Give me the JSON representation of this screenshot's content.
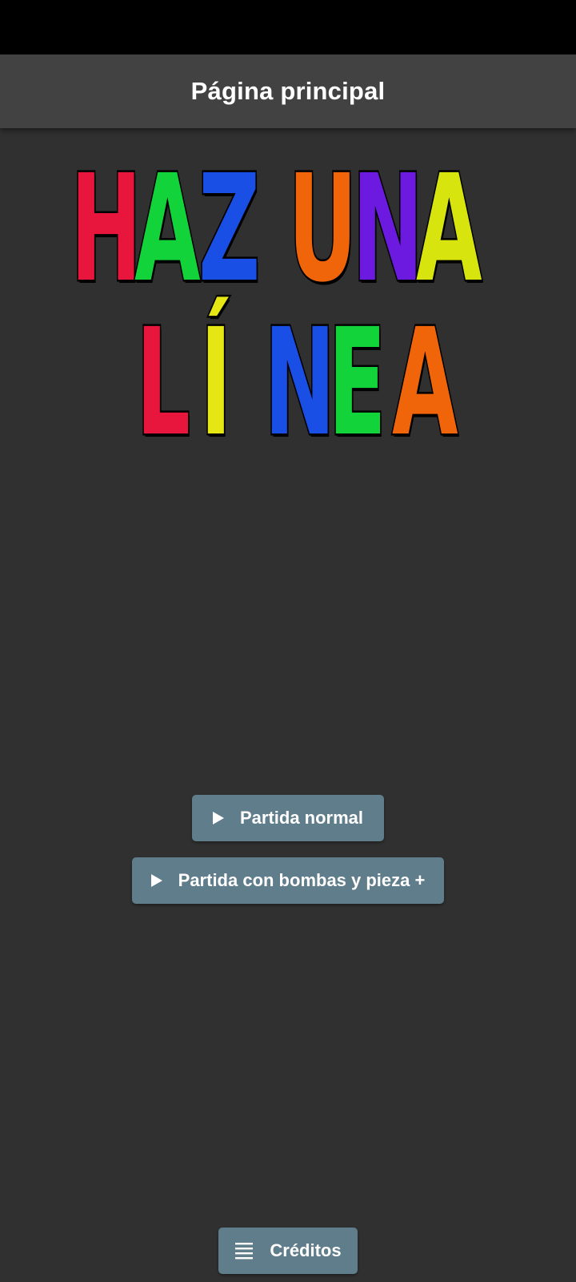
{
  "app_bar": {
    "title": "Página principal"
  },
  "logo": {
    "line1": [
      {
        "char": "H",
        "color": "#e8163c"
      },
      {
        "char": "A",
        "color": "#12d43a"
      },
      {
        "char": "Z",
        "color": "#1a4fe6"
      },
      {
        "char": " ",
        "color": "#000000"
      },
      {
        "char": "U",
        "color": "#f0640a"
      },
      {
        "char": "N",
        "color": "#6c1ae0"
      },
      {
        "char": "A",
        "color": "#d8e40e"
      }
    ],
    "line2": [
      {
        "char": "L",
        "color": "#e8163c"
      },
      {
        "char": "Í",
        "color": "#e6e614"
      },
      {
        "char": "N",
        "color": "#1a4fe6"
      },
      {
        "char": "E",
        "color": "#12d43a"
      },
      {
        "char": "A",
        "color": "#f0640a"
      }
    ]
  },
  "buttons": {
    "normal": {
      "label": "Partida normal",
      "icon": "play-icon"
    },
    "bombs": {
      "label": "Partida con bombas y pieza +",
      "icon": "play-icon"
    },
    "credits": {
      "label": "Créditos",
      "icon": "list-icon"
    }
  },
  "colors": {
    "background": "#303030",
    "app_bar": "#424242",
    "button": "#607d8b"
  }
}
